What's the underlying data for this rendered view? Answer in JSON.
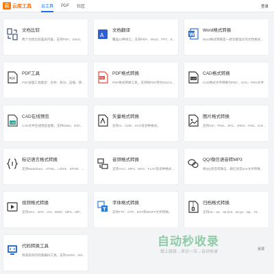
{
  "app": {
    "logo_mark": "云",
    "logo_text": "云库工具",
    "login": "登录"
  },
  "tabs": [
    {
      "label": "云工具"
    },
    {
      "label": "PDF"
    },
    {
      "label": "社区"
    }
  ],
  "tools": [
    {
      "title": "文档比较",
      "desc": "两个文档比较差异内容，支持PDF、Word、",
      "icon": "compare-icon",
      "color": "#3c4b80"
    },
    {
      "title": "文档翻译",
      "desc": "覆盖12种语言，支持PDF、Word、PPT、E...",
      "icon": "translate-icon",
      "color": "#2f5fd0"
    },
    {
      "title": "Word格式转换",
      "desc": "Word格式转换是一款功能强大的文档格式...",
      "icon": "word-icon",
      "color": "#2b6fd6"
    },
    {
      "title": "PDF工具",
      "desc": "PDF处理工具集合：合并、拆分、压缩、转...",
      "icon": "pdf-tool-icon",
      "color": "#333333"
    },
    {
      "title": "PDF格式转换",
      "desc": "PDF格式转换工具，支持将PDF转为DOCX...",
      "icon": "pdf-convert-icon",
      "color": "#e2473a"
    },
    {
      "title": "CAD格式转换",
      "desc": "CAD格式文件转换为PDF、SVG、PNG文件",
      "icon": "cad-convert-icon",
      "color": "#333333"
    },
    {
      "title": "CAD在线预览",
      "desc": "CAD文件在线预览查看，支持DWG、DXF...",
      "icon": "cad-preview-icon",
      "color": "#2a9d8f"
    },
    {
      "title": "矢量格式转换",
      "desc": "支持AI、CDR、SVG等多种格式。",
      "icon": "vector-icon",
      "color": "#333333"
    },
    {
      "title": "图片格式转换",
      "desc": "支持GIF、PNG、JPG、JPEG、PSD、ICO...",
      "icon": "image-convert-icon",
      "color": "#333333"
    },
    {
      "title": "标记语言格式转换",
      "desc": "支持Markdown、HTML、LaTeX、EPUB、...",
      "icon": "markup-icon",
      "color": "#333333"
    },
    {
      "title": "音频格式转换",
      "desc": "支持AAC、MP3、WAV、FLAC等多种格式...",
      "icon": "audio-icon",
      "color": "#333333"
    },
    {
      "title": "QQ/微信语音转MP3",
      "desc": "将QQ语音或微信、微信语音amr文件转换...",
      "icon": "chat-voice-icon",
      "color": "#333333"
    },
    {
      "title": "视频格式转换",
      "desc": "支持3G2、3GP、AVI、MOD、MP4、MP...",
      "icon": "video-icon",
      "color": "#333333"
    },
    {
      "title": "字体格式转换",
      "desc": "支持TTF、OTF、EOT和WOFF文件转换。",
      "icon": "font-icon",
      "color": "#2b7bd6"
    },
    {
      "title": "归档格式转换",
      "desc": "支持rar、tar、tar.bz2、tar.gz、zip、7Z...",
      "icon": "archive-icon",
      "color": "#333333"
    },
    {
      "title": "代码转换工具",
      "desc": "快速高效的同类编码工具，支持JSON、XM...",
      "icon": "code-icon",
      "color": "#2b6fd6"
    }
  ],
  "watermark": {
    "main": "自动秒收录",
    "sub": "做上链接→来访一次→自动收录",
    "feedback": "反馈"
  }
}
